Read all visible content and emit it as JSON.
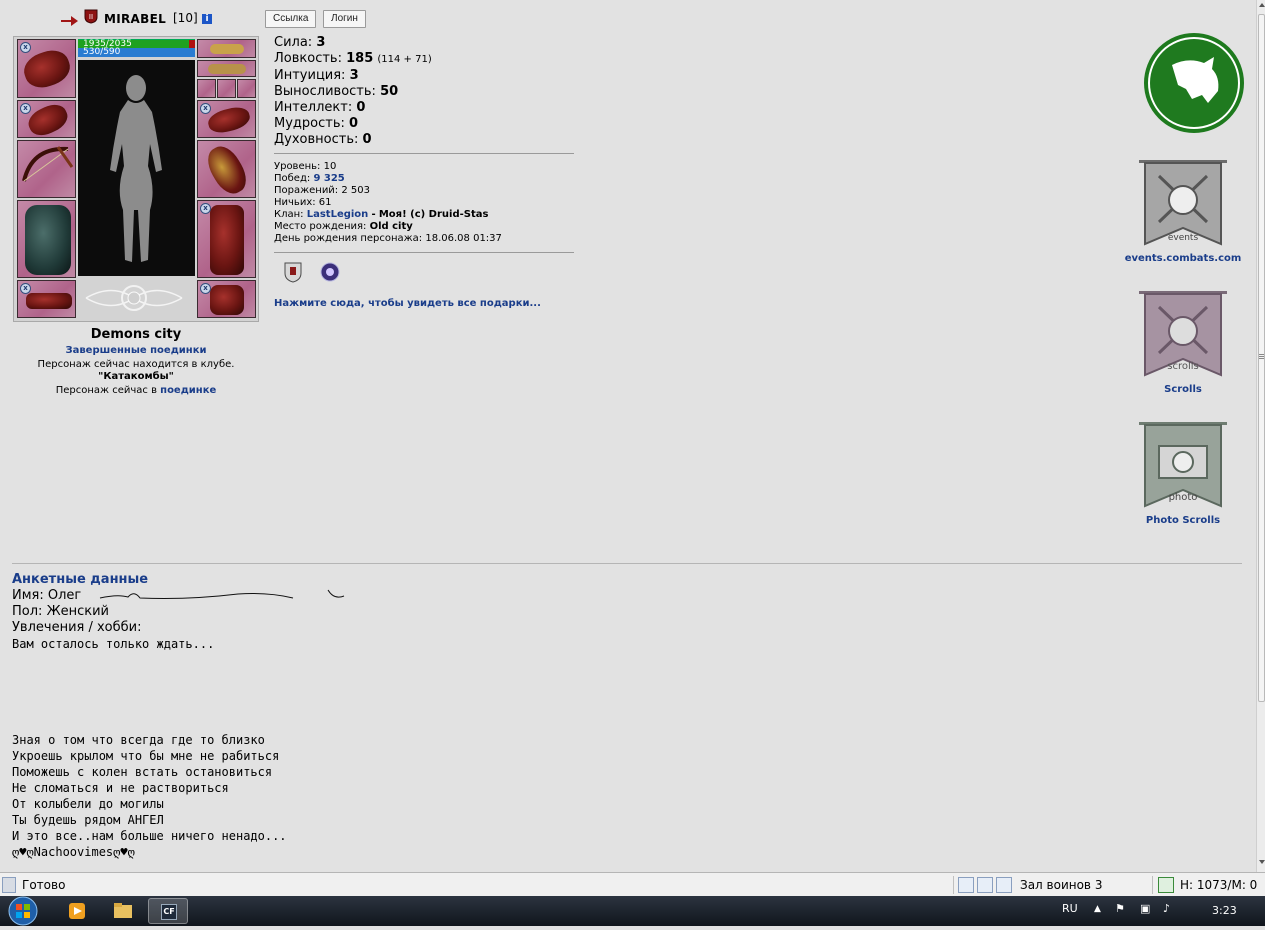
{
  "header": {
    "nickname": "MIRABEL",
    "level": "[10]",
    "info_icon": "info-icon",
    "link_button": "Ссылка",
    "login_button": "Логин"
  },
  "character": {
    "hp": "1935/2035",
    "mp": "530/590",
    "hp_fraction": 0.95,
    "mp_fraction": 0.9,
    "city": "Demons city",
    "finished_fights_link": "Завершенные поединки",
    "club_status": "Персонаж сейчас находится в клубе.",
    "club_location": "\"Катакомбы\"",
    "fight_status_prefix": "Персонаж сейчас в",
    "fight_status_link": "поединке"
  },
  "stats": [
    {
      "label": "Сила:",
      "value": "3",
      "extra": ""
    },
    {
      "label": "Ловкость:",
      "value": "185",
      "extra": "(114 + 71)"
    },
    {
      "label": "Интуиция:",
      "value": "3",
      "extra": ""
    },
    {
      "label": "Выносливость:",
      "value": "50",
      "extra": ""
    },
    {
      "label": "Интеллект:",
      "value": "0",
      "extra": ""
    },
    {
      "label": "Мудрость:",
      "value": "0",
      "extra": ""
    },
    {
      "label": "Духовность:",
      "value": "0",
      "extra": ""
    }
  ],
  "info": {
    "level_label": "Уровень:",
    "level_value": "10",
    "wins_label": "Побед:",
    "wins_value": "9 325",
    "losses_label": "Поражений:",
    "losses_value": "2 503",
    "draws_label": "Ничьих:",
    "draws_value": "61",
    "clan_label": "Клан:",
    "clan_value": "LastLegion",
    "clan_sep": "-",
    "clan_rank": "Моя! (c) Druid-Stas",
    "birthplace_label": "Место рождения:",
    "birthplace_value": "Old city",
    "birthday_label": "День рождения персонажа:",
    "birthday_value": "18.06.08 01:37"
  },
  "gifts_link": "Нажмите сюда, чтобы увидеть все подарки...",
  "right_banners": [
    {
      "caption": "events.combats.com",
      "emblem_text": "events",
      "color": "#707070"
    },
    {
      "caption": "Scrolls",
      "emblem_text": "scrolls",
      "color": "#7a6a78"
    },
    {
      "caption": "Photo Scrolls",
      "emblem_text": "photo",
      "color": "#6f7d72"
    }
  ],
  "anketa": {
    "title": "Анкетные данные",
    "name_label": "Имя:",
    "name_value": "Олег",
    "gender_label": "Пол:",
    "gender_value": "Женский",
    "hobby_label": "Увлечения / хобби:",
    "line1": "Вам осталось только ждать...",
    "poem": [
      "Зная о том что всегда где то близко",
      "Укроешь крылом что бы мне не рабиться",
      "Поможешь с колен встать остановиться",
      "Не сломаться и не раствориться",
      "От колыбели до могилы",
      "Ты будешь рядом АНГЕЛ",
      "И это все..нам больше ничего ненадо..."
    ],
    "signature": "ღ♥ღNachoovimesღ♥ღ"
  },
  "statusbar": {
    "ready": "Готово",
    "zone": "Зал воинов 3",
    "counter": "H: 1073/M: 0"
  },
  "taskbar": {
    "lang": "RU",
    "time": "3:23",
    "app_label": "CF"
  },
  "colors": {
    "page_bg": "#e2e2e2",
    "link": "#1a3d8a",
    "hp": "#1fa11f",
    "mp": "#2a7cd1",
    "logo_green": "#1e7a1e"
  }
}
